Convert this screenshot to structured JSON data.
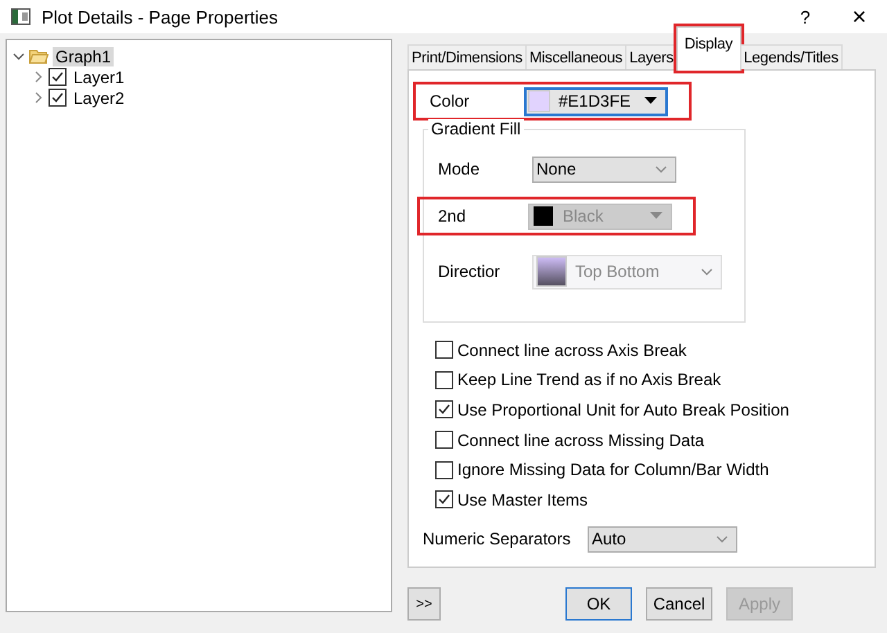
{
  "window": {
    "title": "Plot Details - Page Properties",
    "help_button": "?",
    "close_button": "×"
  },
  "tree": [
    {
      "label": "Graph1",
      "expanded": true,
      "selected": true,
      "children": [
        {
          "label": "Layer1",
          "checked": true,
          "expanded": false,
          "selected": false
        },
        {
          "label": "Layer2",
          "checked": true,
          "expanded": false,
          "selected": false
        }
      ]
    }
  ],
  "tabs": [
    {
      "label": "Print/Dimensions",
      "selected": false,
      "highlighted": false
    },
    {
      "label": "Miscellaneous",
      "selected": false,
      "highlighted": false
    },
    {
      "label": "Layers",
      "selected": false,
      "highlighted": false
    },
    {
      "label": "Display",
      "selected": true,
      "highlighted": true
    },
    {
      "label": "Legends/Titles",
      "selected": false,
      "highlighted": false
    }
  ],
  "color": {
    "label": "Color",
    "value": "#E1D3FE",
    "color": "#e1d3fe",
    "highlighted": true
  },
  "gradient_fill": {
    "title": "Gradient Fill",
    "mode": {
      "label": "Mode",
      "value": "None",
      "highlighted": false
    },
    "second": {
      "label": "2nd",
      "value": "Black",
      "color": "#000000",
      "disabled": true,
      "highlighted": true
    },
    "direction": {
      "label": "Directior",
      "value": "Top Bottom",
      "disabled": true
    }
  },
  "options": [
    {
      "label": "Connect line across Axis Break",
      "checked": false
    },
    {
      "label": "Keep Line Trend as if no Axis Break",
      "checked": false
    },
    {
      "label": "Use Proportional Unit for Auto Break Position",
      "checked": true
    },
    {
      "label": "Connect line across Missing Data",
      "checked": false
    },
    {
      "label": "Ignore Missing Data for Column/Bar Width",
      "checked": false
    },
    {
      "label": "Use Master Items",
      "checked": true
    }
  ],
  "numeric_separators": {
    "label": "Numeric Separators",
    "value": "Auto"
  },
  "buttons": [
    {
      "label": ">>",
      "kind": "more",
      "disabled": false
    },
    {
      "label": "OK",
      "kind": "default",
      "disabled": false
    },
    {
      "label": "Cancel",
      "kind": "normal",
      "disabled": false
    },
    {
      "label": "Apply",
      "kind": "normal",
      "disabled": true
    }
  ]
}
